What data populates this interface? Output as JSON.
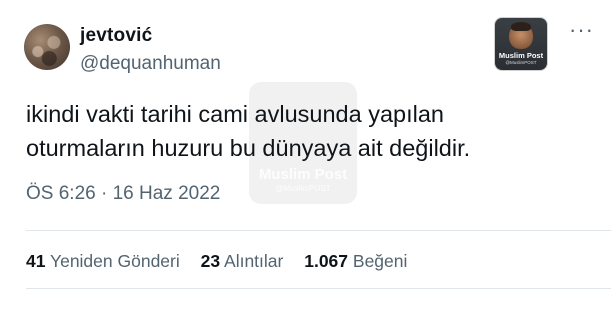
{
  "tweet": {
    "author": {
      "name": "jevtović",
      "handle": "@dequanhuman"
    },
    "badge": {
      "title": "Muslim Post",
      "subtitle": "@MuslimPOST"
    },
    "more_icon": "more-horizontal-icon",
    "text_lines": [
      "ikindi vakti tarihi cami avlusunda yapılan",
      "oturmaların huzuru bu dünyaya ait değildir."
    ],
    "watermark": {
      "title": "Muslim Post",
      "subtitle": "@MuslimPOST"
    },
    "timestamp": "ÖS 6:26 · 16 Haz 2022",
    "stats": [
      {
        "count": "41",
        "label": "Yeniden Gönderi"
      },
      {
        "count": "23",
        "label": "Alıntılar"
      },
      {
        "count": "1.067",
        "label": "Beğeni"
      }
    ]
  }
}
